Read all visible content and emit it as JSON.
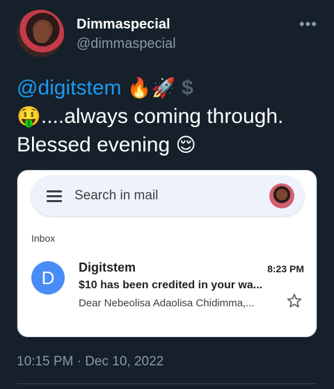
{
  "author": {
    "display_name": "Dimmaspecial",
    "handle": "@dimmaspecial",
    "more_icon": "more-horizontal-icon"
  },
  "tweet": {
    "mention": "@digitstem",
    "emoji_1": "🔥",
    "emoji_2": "🚀",
    "dollar": "$",
    "emoji_3": "🤑",
    "line_2_text": "....always coming through.",
    "line_3_text": "Blessed evening",
    "emoji_4": "😌",
    "timestamp": "10:15 PM · Dec 10, 2022"
  },
  "email_card": {
    "search_placeholder": "Search in mail",
    "folder_label": "Inbox",
    "sender_initial": "D",
    "sender_name": "Digitstem",
    "time": "8:23 PM",
    "subject": "$10 has been credited in your wa...",
    "preview": "Dear Nebeolisa Adaolisa Chidimma,...",
    "accent_color": "#4a8cf7"
  },
  "colors": {
    "background": "#15202b",
    "mention": "#1d9bf0",
    "secondary_text": "#8b98a5"
  }
}
